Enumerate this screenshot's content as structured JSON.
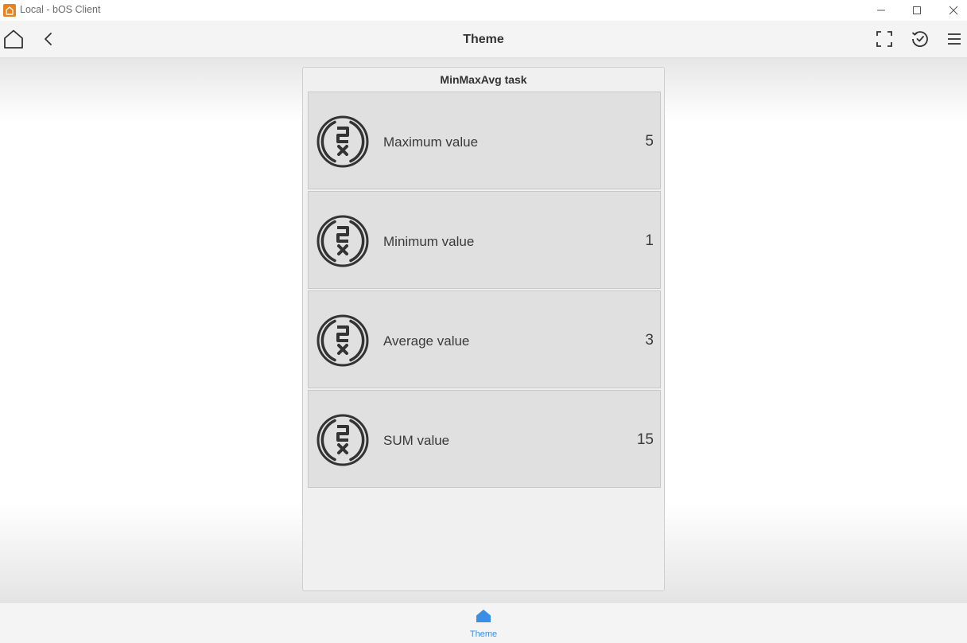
{
  "window": {
    "title": "Local - bOS Client"
  },
  "header": {
    "title": "Theme"
  },
  "panel": {
    "title": "MinMaxAvg task",
    "tiles": [
      {
        "label": "Maximum value",
        "value": "5",
        "icon": "min-max-avg-icon"
      },
      {
        "label": "Minimum value",
        "value": "1",
        "icon": "min-max-avg-icon"
      },
      {
        "label": "Average value",
        "value": "3",
        "icon": "min-max-avg-icon"
      },
      {
        "label": "SUM value",
        "value": "15",
        "icon": "min-max-avg-icon"
      }
    ]
  },
  "bottom_nav": {
    "tabs": [
      {
        "label": "Theme",
        "icon": "home-icon",
        "active": true
      }
    ]
  },
  "colors": {
    "brand": "#e8821e",
    "accent": "#3a8ee6",
    "tile_bg": "#e0e0e0",
    "text": "#333333"
  }
}
